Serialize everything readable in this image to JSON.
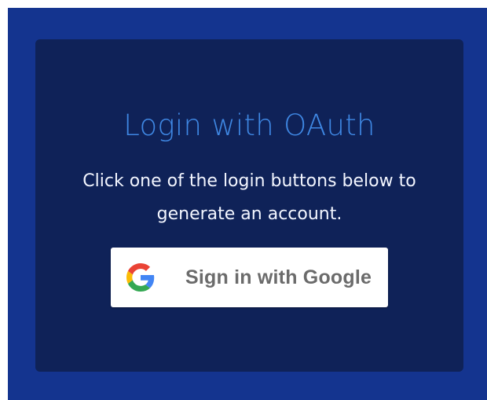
{
  "login": {
    "title": "Login with OAuth",
    "description": "Click one of the login buttons below to generate an account.",
    "google_button_label": "Sign in with Google"
  },
  "colors": {
    "frame_bg": "#14348f",
    "card_bg": "#0f2258",
    "title": "#3f88e4",
    "text": "#f3f6ff",
    "button_bg": "#ffffff",
    "button_text": "#6b6b6b"
  },
  "icons": {
    "google": "google-g-icon"
  }
}
